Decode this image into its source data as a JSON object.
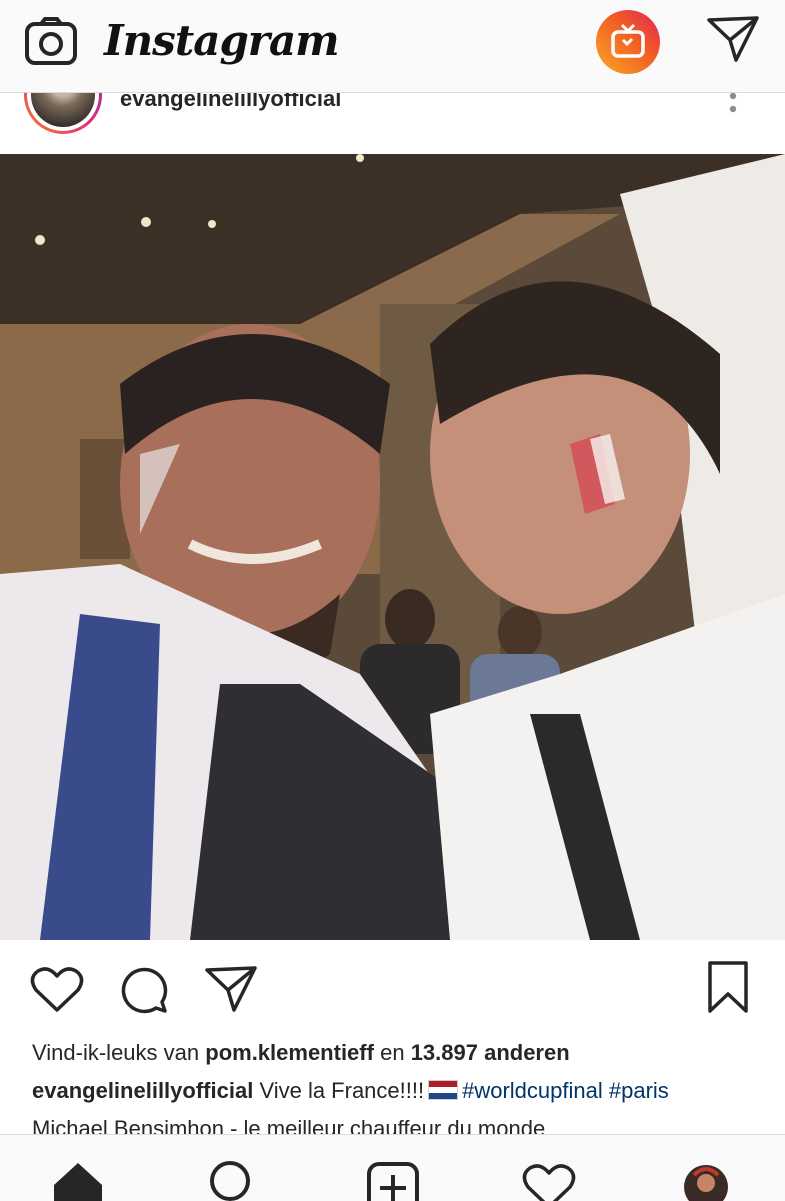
{
  "app": {
    "title": "Instagram"
  },
  "top_bar": {
    "left_icon": "camera-icon",
    "right_icons": [
      "igtv-icon",
      "direct-message-icon"
    ]
  },
  "post": {
    "username": "evangelinelillyofficial",
    "photo_description_icon": "post-photo",
    "actions": [
      "like-icon",
      "comment-icon",
      "share-icon",
      "bookmark-icon"
    ],
    "likes": {
      "prefix": "Vind-ik-leuks van",
      "user": "pom.klementieff",
      "middle": "en",
      "count": "13.897 anderen"
    },
    "caption": {
      "user": "evangelinelillyofficial",
      "text": "Vive la France!!!!",
      "flag": "nl-flag",
      "hashtags": [
        "#worldcupfinal",
        "#paris"
      ],
      "line2": "Michael Bensimhon - le meilleur chauffeur du monde"
    }
  },
  "bottom_nav": [
    "home-icon",
    "search-icon",
    "new-post-icon",
    "activity-icon",
    "profile-avatar"
  ]
}
